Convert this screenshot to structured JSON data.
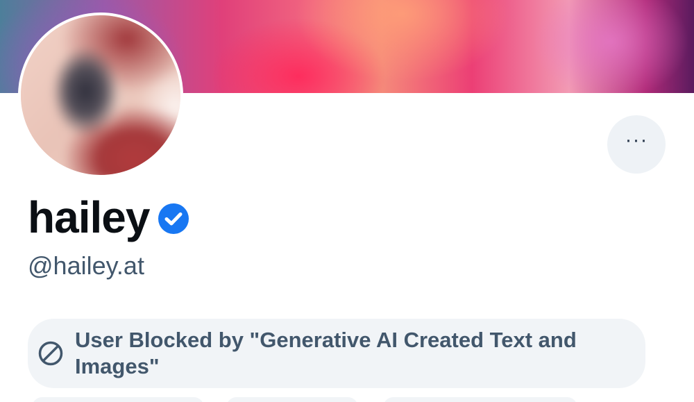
{
  "profile": {
    "display_name": "hailey",
    "handle": "@hailey.at",
    "verified": true,
    "more_button_label": "···"
  },
  "moderation": {
    "notice": "User Blocked by \"Generative AI Created Text and Images\""
  },
  "colors": {
    "verified_badge": "#1877f2",
    "notice_bg": "#f1f4f7",
    "secondary_text": "#42576c"
  },
  "icons": {
    "verified": "check-badge-icon",
    "blocked": "ban-icon",
    "more": "ellipsis-icon"
  }
}
